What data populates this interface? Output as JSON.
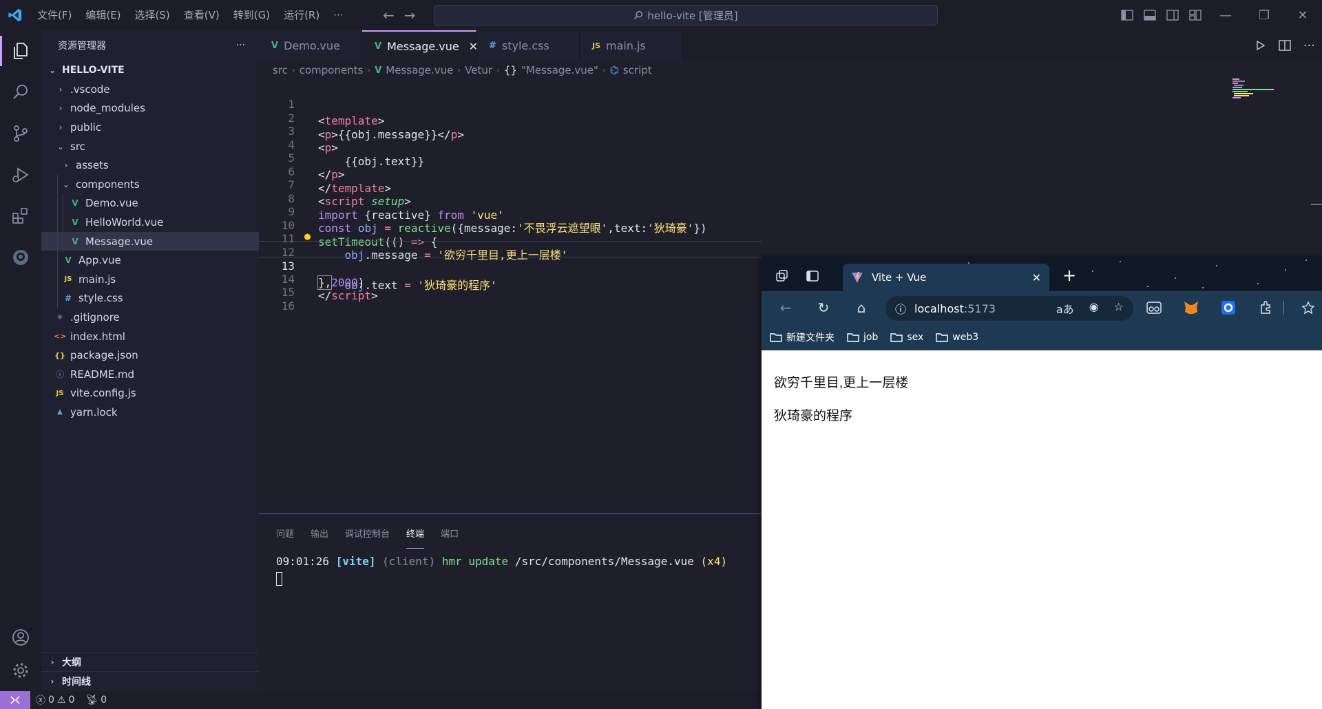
{
  "titlebar": {
    "menus": [
      "文件(F)",
      "编辑(E)",
      "选择(S)",
      "查看(V)",
      "转到(G)",
      "运行(R)",
      "···"
    ],
    "search_text": "hello-vite [管理员]"
  },
  "sidebar": {
    "title": "资源管理器",
    "more": "···",
    "root": "HELLO-VITE",
    "items": [
      {
        "label": ".vscode",
        "chevron": "›"
      },
      {
        "label": "node_modules",
        "chevron": "›"
      },
      {
        "label": "public",
        "chevron": "›"
      },
      {
        "label": "src",
        "chevron": "⌄"
      },
      {
        "label": "assets",
        "chevron": "›"
      },
      {
        "label": "components",
        "chevron": "⌄"
      },
      {
        "label": "Demo.vue",
        "icon": "V"
      },
      {
        "label": "HelloWorld.vue",
        "icon": "V"
      },
      {
        "label": "Message.vue",
        "icon": "V"
      },
      {
        "label": "App.vue",
        "icon": "V"
      },
      {
        "label": "main.js",
        "icon": "JS"
      },
      {
        "label": "style.css",
        "icon": "#"
      },
      {
        "label": ".gitignore",
        "icon": "◆"
      },
      {
        "label": "index.html",
        "icon": "<>"
      },
      {
        "label": "package.json",
        "icon": "{}"
      },
      {
        "label": "README.md",
        "icon": "ⓘ"
      },
      {
        "label": "vite.config.js",
        "icon": "JS"
      },
      {
        "label": "yarn.lock",
        "icon": "▲"
      }
    ],
    "outline": "大纲",
    "timeline": "时间线"
  },
  "tabs": [
    {
      "label": "Demo.vue",
      "icon": "V"
    },
    {
      "label": "Message.vue",
      "icon": "V",
      "close": "✕"
    },
    {
      "label": "style.css",
      "icon": "#"
    },
    {
      "label": "main.js",
      "icon": "JS"
    }
  ],
  "breadcrumb": {
    "src": "src",
    "components": "components",
    "file": "Message.vue",
    "vetur": "Vetur",
    "braces": "{}",
    "obj": "\"Message.vue\"",
    "script": "script"
  },
  "editor": {
    "line_numbers": [
      "1",
      "2",
      "3",
      "4",
      "5",
      "6",
      "7",
      "8",
      "9",
      "10",
      "11",
      "12",
      "13",
      "14",
      "15",
      "16"
    ],
    "current_line": "13",
    "l1": "template",
    "l2a": "p",
    "l2b": "{{obj.message}}",
    "l2c": "p",
    "l3": "p",
    "l4": "{{obj.text}}",
    "l5": "p",
    "l6": "template",
    "l7a": "script",
    "l7b": "setup",
    "l8a": "import",
    "l8b": "{reactive}",
    "l8c": "from",
    "l8d": "'vue'",
    "l9a": "const",
    "l9b": "obj",
    "l9c": "=",
    "l9d": "reactive",
    "l9e": "({message:",
    "l9f": "'不畏浮云遮望眼'",
    "l9g": ",text:",
    "l9h": "'狄琦豪'",
    "l9i": "})",
    "l10a": "setTimeout",
    "l10b": "(() ",
    "l10c": "=>",
    "l10d": " {",
    "l11a": "obj",
    "l11b": ".message ",
    "l11c": "=",
    "l11d": "'欲穷千里目,更上一层楼'",
    "l12a": "obj",
    "l12b": ".text ",
    "l12c": "=",
    "l12d": "'狄琦豪的程序'",
    "l13a": "},",
    "l13b": "2000",
    "l13c": ")",
    "l14": "script"
  },
  "panel": {
    "tabs": [
      "问题",
      "输出",
      "调试控制台",
      "终端",
      "端口"
    ],
    "terminal": {
      "time": "09:01:26",
      "vite": "[vite]",
      "client": "(client)",
      "hmr": "hmr update",
      "path": "/src/components/Message.vue",
      "count": "(x4)"
    }
  },
  "statusbar": {
    "errors": "0",
    "warnings": "0",
    "ports": "0"
  },
  "browser": {
    "tab_title": "Vite + Vue",
    "tab_close": "✕",
    "new_tab": "+",
    "address_host": "localhost",
    "address_port": ":5173",
    "bookmarks": [
      "新建文件夹",
      "job",
      "sex",
      "web3"
    ],
    "page": {
      "message": "欲穷千里目,更上一层楼",
      "text": "狄琦豪的程序"
    }
  },
  "colors": {
    "accent": "#c8a0ff",
    "remote": "#9b6fd6",
    "vue_green": "#41b883",
    "js_yellow": "#e5c84b",
    "css_blue": "#5aa9e6",
    "browser_chrome": "#1d3a52"
  }
}
